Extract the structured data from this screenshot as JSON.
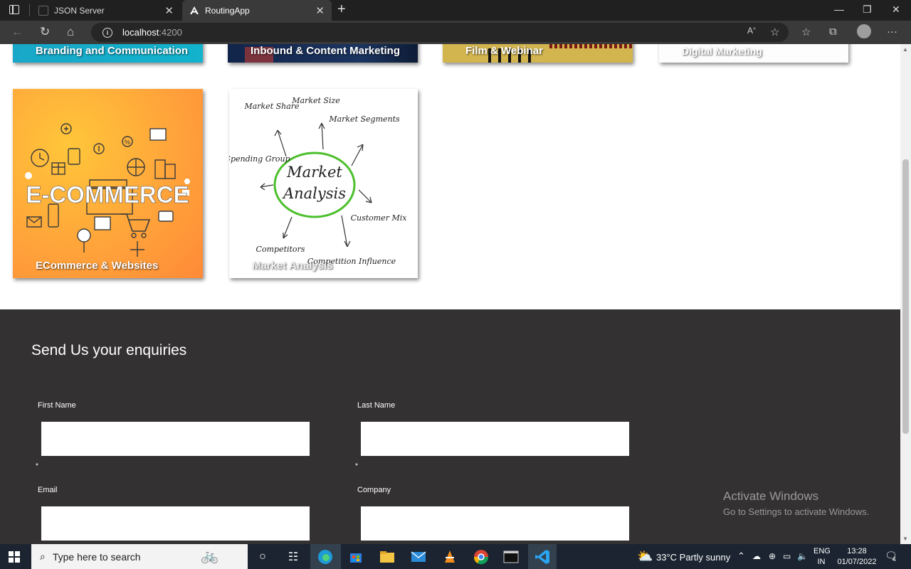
{
  "browser": {
    "tabs": [
      {
        "title": "JSON Server",
        "active": false
      },
      {
        "title": "RoutingApp",
        "active": true
      }
    ],
    "url_host": "localhost",
    "url_port": ":4200",
    "new_tab_label": "+"
  },
  "cards": {
    "top_row": [
      {
        "label": "Branding and Communication"
      },
      {
        "label": "Inbound & Content Marketing"
      },
      {
        "label": "Film & Webinar"
      },
      {
        "label": "Digital Marketing"
      }
    ],
    "ecommerce": {
      "label": "ECommerce & Websites",
      "image_text": "E-COMMERCE"
    },
    "market": {
      "label": "Market Analysis",
      "center_line1": "Market",
      "center_line2": "Analysis",
      "spokes": [
        "Market Share",
        "Market Size",
        "Market Segments",
        "Spending Group",
        "Customer Mix",
        "Competitors",
        "Competition Influence"
      ]
    }
  },
  "form": {
    "title": "Send Us your enquiries",
    "first_name_label": "First Name",
    "last_name_label": "Last Name",
    "email_label": "Email",
    "company_label": "Company",
    "required_mark": "*"
  },
  "watermark": {
    "line1": "Activate Windows",
    "line2": "Go to Settings to activate Windows."
  },
  "taskbar": {
    "search_placeholder": "Type here to search",
    "weather": "33°C  Partly sunny",
    "lang_line1": "ENG",
    "lang_line2": "IN",
    "time": "13:28",
    "date": "01/07/2022",
    "notifications": "4"
  }
}
